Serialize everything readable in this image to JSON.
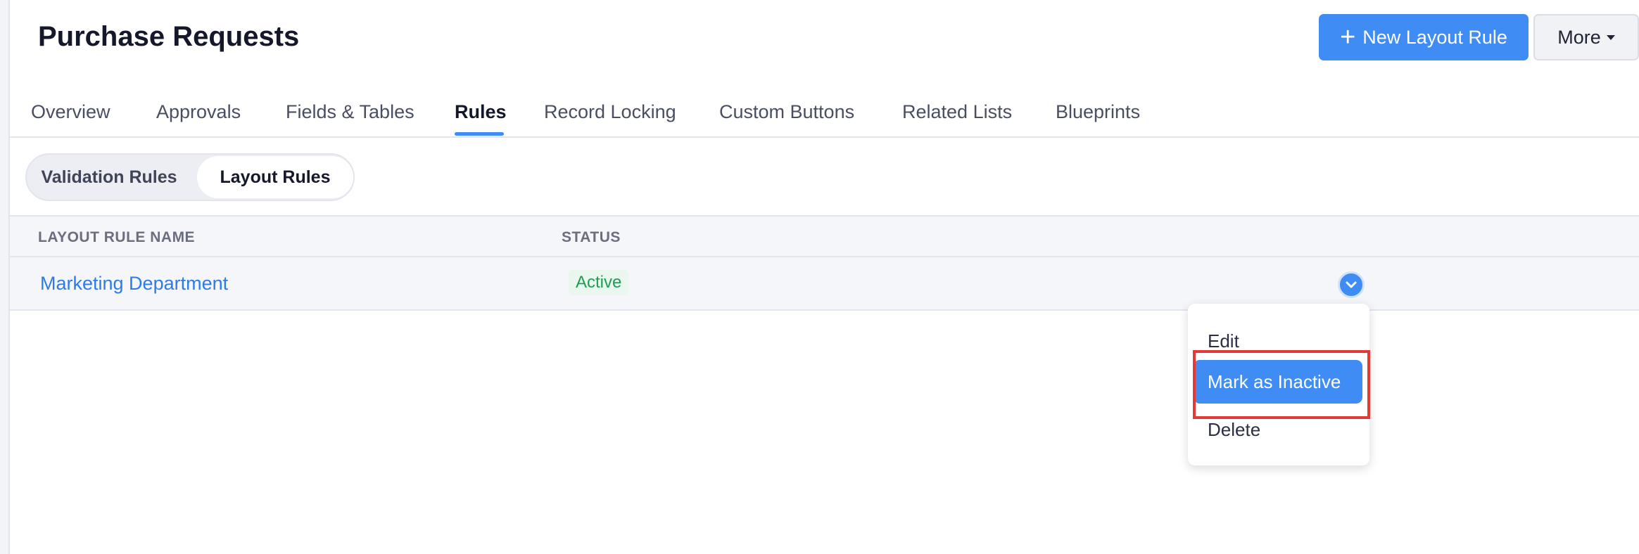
{
  "header": {
    "title": "Purchase Requests",
    "new_button_label": "New Layout Rule",
    "more_button_label": "More"
  },
  "tabs": [
    {
      "label": "Overview"
    },
    {
      "label": "Approvals"
    },
    {
      "label": "Fields & Tables"
    },
    {
      "label": "Rules",
      "active": true
    },
    {
      "label": "Record Locking"
    },
    {
      "label": "Custom Buttons"
    },
    {
      "label": "Related Lists"
    },
    {
      "label": "Blueprints"
    }
  ],
  "segmented": {
    "options": [
      "Validation Rules",
      "Layout Rules"
    ],
    "selected": "Layout Rules"
  },
  "table": {
    "columns": [
      "LAYOUT RULE NAME",
      "STATUS"
    ],
    "rows": [
      {
        "name": "Marketing Department",
        "status": "Active"
      }
    ]
  },
  "row_menu": {
    "items": [
      "Edit",
      "Mark as Inactive",
      "Delete"
    ],
    "highlighted": "Mark as Inactive"
  },
  "colors": {
    "accent": "#3f8cf4",
    "status_active": "#1f9d55",
    "highlight_box": "#e53935"
  }
}
